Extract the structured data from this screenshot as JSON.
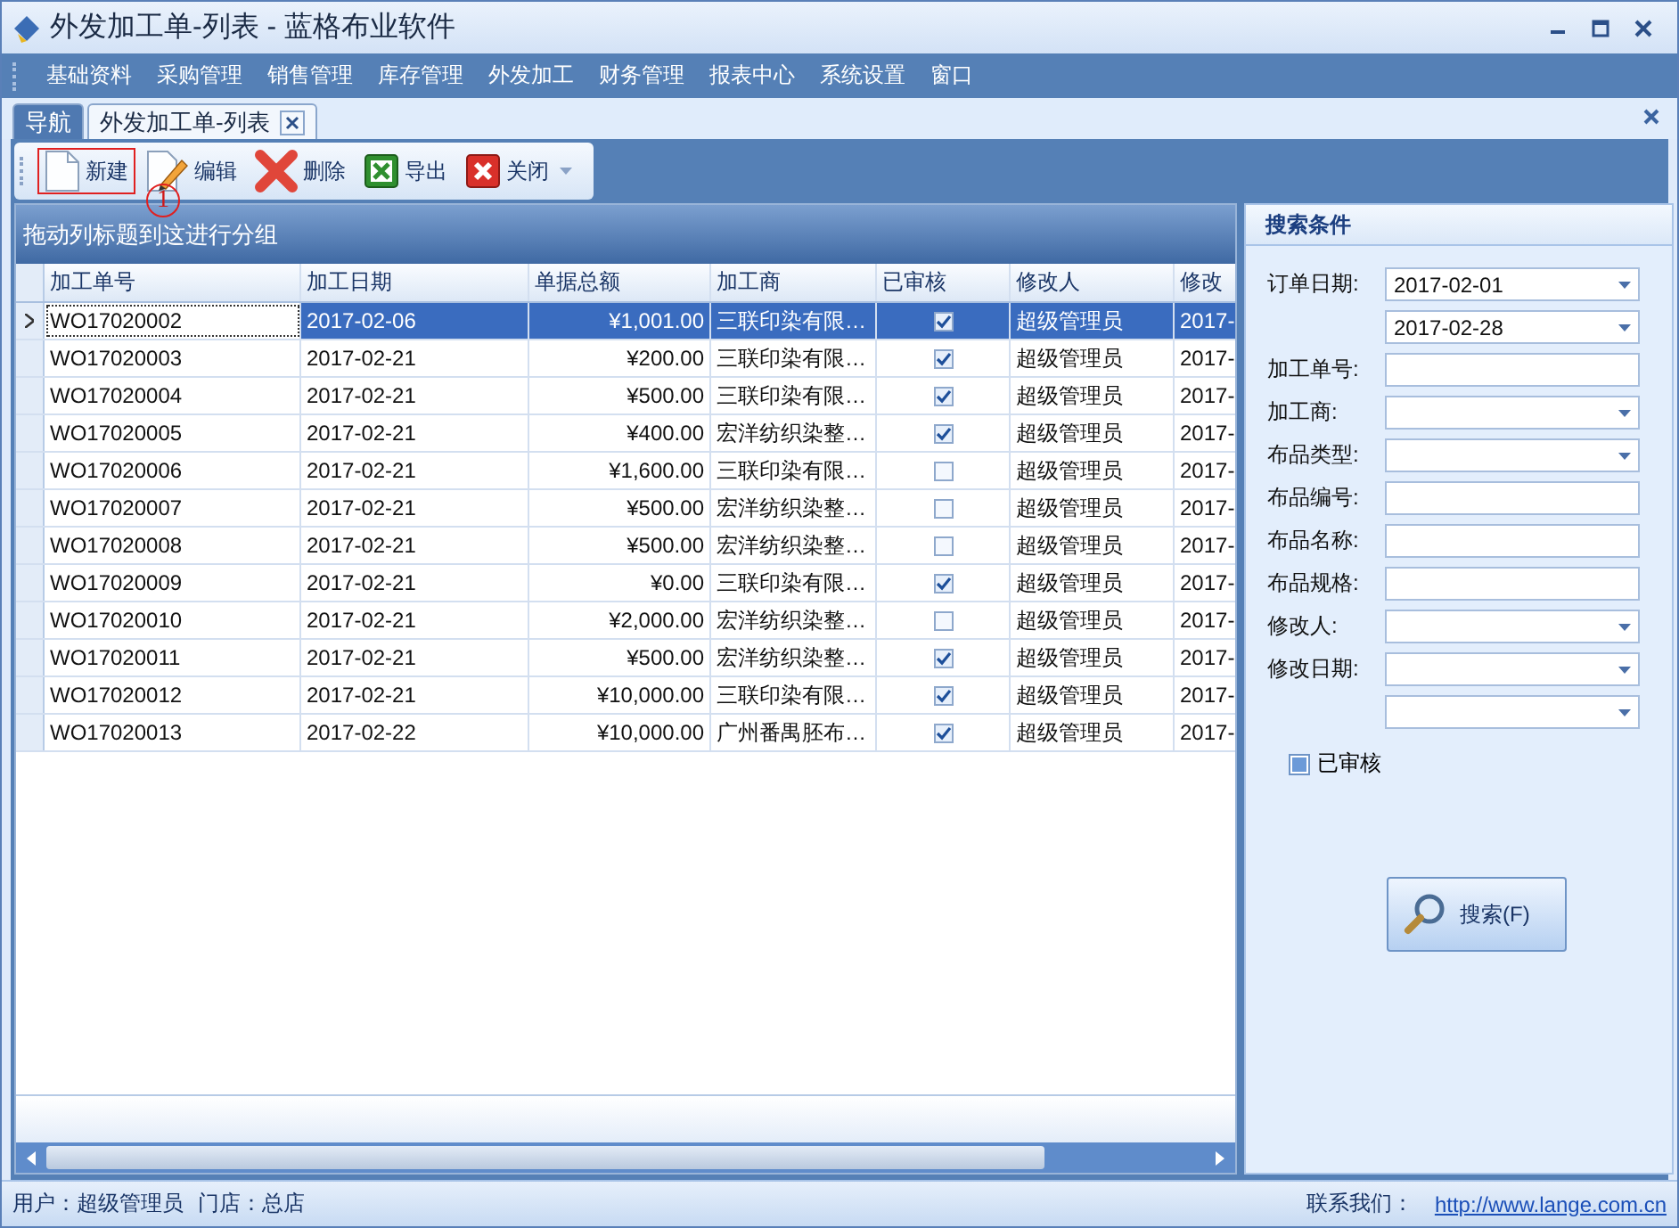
{
  "window": {
    "title": "外发加工单-列表 - 蓝格布业软件"
  },
  "menu": [
    "基础资料",
    "采购管理",
    "销售管理",
    "库存管理",
    "外发加工",
    "财务管理",
    "报表中心",
    "系统设置",
    "窗口"
  ],
  "tabs": [
    {
      "label": "导航",
      "selected": false
    },
    {
      "label": "外发加工单-列表",
      "selected": true,
      "closable": true
    }
  ],
  "toolbar": [
    {
      "label": "新建",
      "kind": "new",
      "highlighted": true
    },
    {
      "label": "编辑",
      "kind": "edit",
      "highlighted": false
    },
    {
      "label": "删除",
      "kind": "delete",
      "highlighted": false
    },
    {
      "label": "导出",
      "kind": "export",
      "highlighted": false
    },
    {
      "label": "关闭",
      "kind": "close",
      "highlighted": false
    }
  ],
  "annotation": {
    "label": "1"
  },
  "group_panel": "拖动列标题到这进行分组",
  "table": {
    "columns": [
      "加工单号",
      "加工日期",
      "单据总额",
      "加工商",
      "已审核",
      "修改人",
      "修改"
    ],
    "rows": [
      {
        "no": "WO17020002",
        "date": "2017-02-06",
        "amount": "¥1,001.00",
        "vendor": "三联印染有限…",
        "checked": true,
        "editor": "超级管理员",
        "modified": "2017-",
        "selected": true
      },
      {
        "no": "WO17020003",
        "date": "2017-02-21",
        "amount": "¥200.00",
        "vendor": "三联印染有限…",
        "checked": true,
        "editor": "超级管理员",
        "modified": "2017-",
        "selected": false
      },
      {
        "no": "WO17020004",
        "date": "2017-02-21",
        "amount": "¥500.00",
        "vendor": "三联印染有限…",
        "checked": true,
        "editor": "超级管理员",
        "modified": "2017-",
        "selected": false
      },
      {
        "no": "WO17020005",
        "date": "2017-02-21",
        "amount": "¥400.00",
        "vendor": "宏洋纺织染整…",
        "checked": true,
        "editor": "超级管理员",
        "modified": "2017-",
        "selected": false
      },
      {
        "no": "WO17020006",
        "date": "2017-02-21",
        "amount": "¥1,600.00",
        "vendor": "三联印染有限…",
        "checked": false,
        "editor": "超级管理员",
        "modified": "2017-",
        "selected": false
      },
      {
        "no": "WO17020007",
        "date": "2017-02-21",
        "amount": "¥500.00",
        "vendor": "宏洋纺织染整…",
        "checked": false,
        "editor": "超级管理员",
        "modified": "2017-",
        "selected": false
      },
      {
        "no": "WO17020008",
        "date": "2017-02-21",
        "amount": "¥500.00",
        "vendor": "宏洋纺织染整…",
        "checked": false,
        "editor": "超级管理员",
        "modified": "2017-",
        "selected": false
      },
      {
        "no": "WO17020009",
        "date": "2017-02-21",
        "amount": "¥0.00",
        "vendor": "三联印染有限…",
        "checked": true,
        "editor": "超级管理员",
        "modified": "2017-",
        "selected": false
      },
      {
        "no": "WO17020010",
        "date": "2017-02-21",
        "amount": "¥2,000.00",
        "vendor": "宏洋纺织染整…",
        "checked": false,
        "editor": "超级管理员",
        "modified": "2017-",
        "selected": false
      },
      {
        "no": "WO17020011",
        "date": "2017-02-21",
        "amount": "¥500.00",
        "vendor": "宏洋纺织染整…",
        "checked": true,
        "editor": "超级管理员",
        "modified": "2017-",
        "selected": false
      },
      {
        "no": "WO17020012",
        "date": "2017-02-21",
        "amount": "¥10,000.00",
        "vendor": "三联印染有限…",
        "checked": true,
        "editor": "超级管理员",
        "modified": "2017-",
        "selected": false
      },
      {
        "no": "WO17020013",
        "date": "2017-02-22",
        "amount": "¥10,000.00",
        "vendor": "广州番禺胚布…",
        "checked": true,
        "editor": "超级管理员",
        "modified": "2017-",
        "selected": false
      }
    ]
  },
  "search": {
    "title": "搜索条件",
    "fields": [
      {
        "label": "订单日期:",
        "kind": "dropdown",
        "value": "2017-02-01"
      },
      {
        "kind": "dropdown",
        "value": "2017-02-28"
      },
      {
        "label": "加工单号:",
        "kind": "text"
      },
      {
        "label": "加工商:",
        "kind": "dropdown"
      },
      {
        "label": "布品类型:",
        "kind": "dropdown"
      },
      {
        "label": "布品编号:",
        "kind": "text"
      },
      {
        "label": "布品名称:",
        "kind": "text"
      },
      {
        "label": "布品规格:",
        "kind": "text"
      },
      {
        "label": "修改人:",
        "kind": "dropdown"
      },
      {
        "label": "修改日期:",
        "kind": "dropdown"
      },
      {
        "kind": "dropdown"
      }
    ],
    "audited": {
      "label": "已审核",
      "indeterminate": true
    },
    "button": "搜索(F)"
  },
  "status_bar": {
    "user": "用户：超级管理员",
    "store": "门店：总店",
    "contact": "联系我们：",
    "link": "http://www.lange.com.cn"
  }
}
